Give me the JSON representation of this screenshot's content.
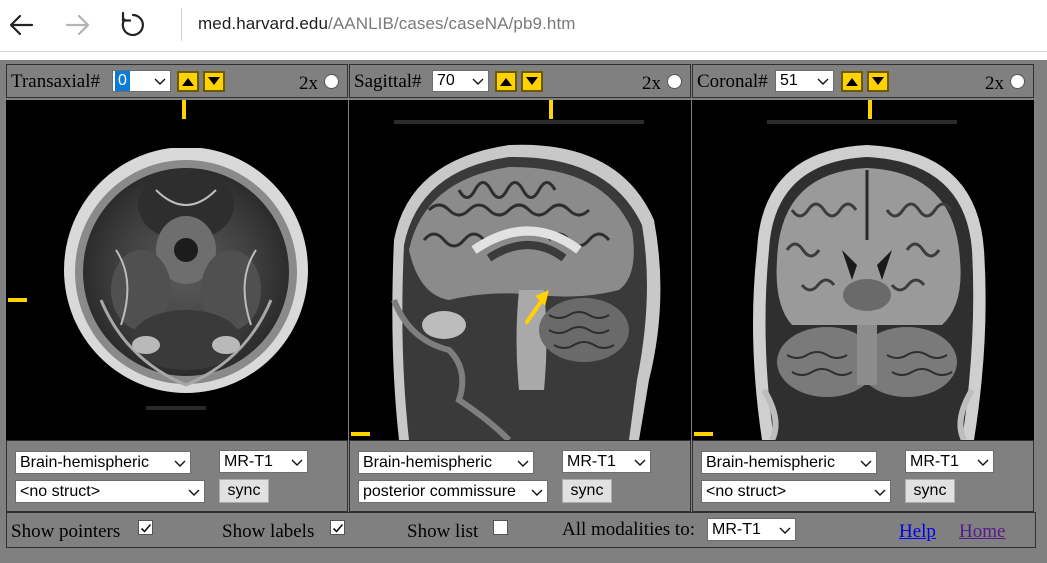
{
  "browser": {
    "back_icon": "back-arrow-icon",
    "forward_icon": "forward-arrow-icon",
    "refresh_icon": "refresh-icon",
    "url_host": "med.harvard.edu",
    "url_path": "/AANLIB/cases/caseNA/pb9.htm"
  },
  "colors": {
    "viewer_background": "#808080",
    "pointer_yellow": "#ffd200",
    "link_blue": "#0000ee",
    "link_purple": "#551a8b"
  },
  "panels": [
    {
      "title": "Transaxial#",
      "slice": "0",
      "slice_selected": true,
      "zoom_label": "2x",
      "zoom_checked": false,
      "region": "Brain-hemispheric",
      "modality": "MR-T1",
      "structure": "<no struct>",
      "sync_label": "sync"
    },
    {
      "title": "Sagittal#",
      "slice": "70",
      "slice_selected": false,
      "zoom_label": "2x",
      "zoom_checked": false,
      "region": "Brain-hemispheric",
      "modality": "MR-T1",
      "structure": "posterior commissure",
      "sync_label": "sync"
    },
    {
      "title": "Coronal#",
      "slice": "51",
      "slice_selected": false,
      "zoom_label": "2x",
      "zoom_checked": false,
      "region": "Brain-hemispheric",
      "modality": "MR-T1",
      "structure": "<no struct>",
      "sync_label": "sync"
    }
  ],
  "bottom": {
    "show_pointers_label": "Show pointers",
    "show_pointers_checked": true,
    "show_labels_label": "Show labels",
    "show_labels_checked": true,
    "show_list_label": "Show list",
    "show_list_checked": false,
    "all_modalities_label": "All modalities to:",
    "all_modalities_value": "MR-T1",
    "help_link": "Help",
    "home_link": "Home"
  }
}
